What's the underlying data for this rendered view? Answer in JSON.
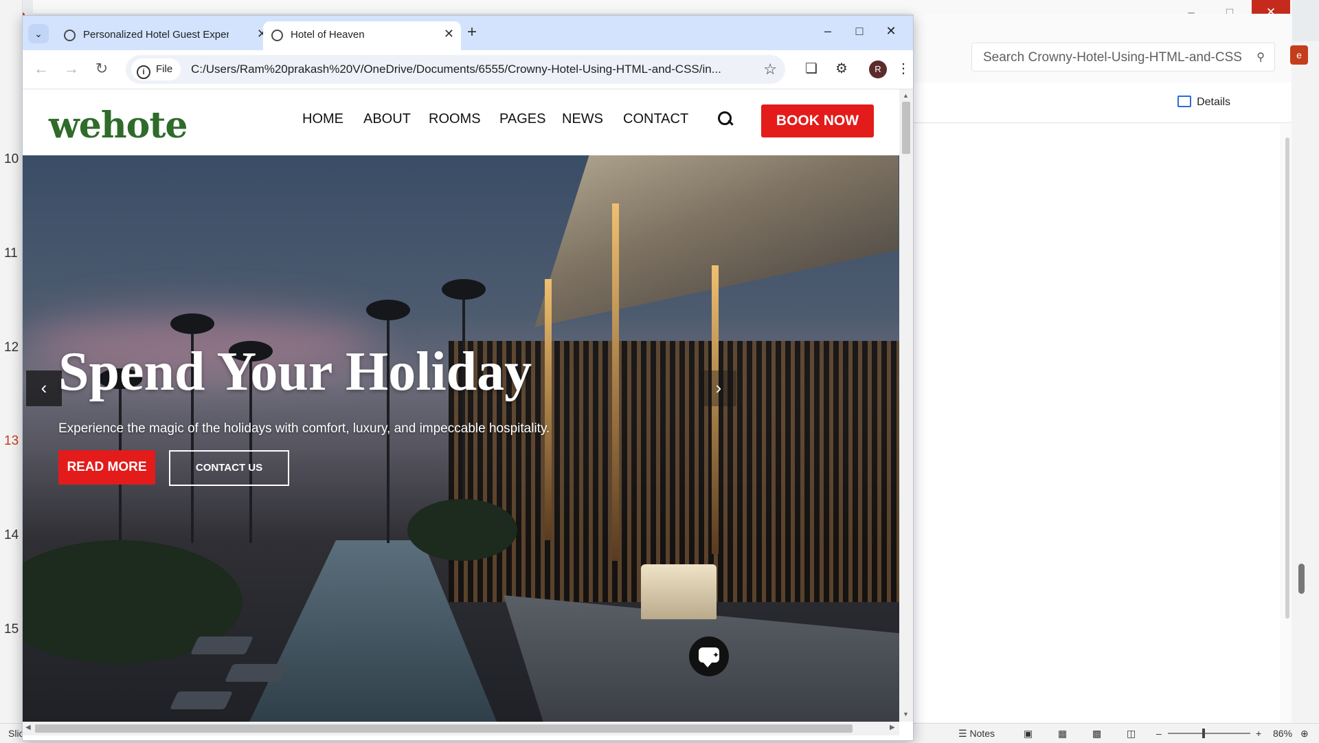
{
  "background_app": {
    "slide_numbers": [
      "10",
      "11",
      "12",
      "13",
      "14",
      "15"
    ],
    "active_slide": "13",
    "explorer_search_placeholder": "Search Crowny-Hotel-Using-HTML-and-CSS",
    "details_label": "Details",
    "status_left": "Slic",
    "notes_label": "Notes",
    "zoom_level": "86%"
  },
  "browser": {
    "tabs": [
      {
        "title": "Personalized Hotel Guest Experi",
        "active": false
      },
      {
        "title": "Hotel of Heaven",
        "active": true
      }
    ],
    "address": {
      "chip_label": "File",
      "url": "C:/Users/Ram%20prakash%20V/OneDrive/Documents/6555/Crowny-Hotel-Using-HTML-and-CSS/in..."
    },
    "profile_initial": "R"
  },
  "site": {
    "logo": "wehote",
    "nav": [
      "HOME",
      "ABOUT",
      "ROOMS",
      "PAGES",
      "NEWS",
      "CONTACT"
    ],
    "book_now": "BOOK NOW",
    "hero": {
      "title": "Spend Your Holiday",
      "subtitle": "Experience the magic of the holidays with comfort, luxury, and impeccable hospitality.",
      "read_more": "READ MORE",
      "contact_us": "CONTACT US"
    }
  },
  "colors": {
    "accent_red": "#e31b1b",
    "logo_green": "#2f6b2a",
    "tabstrip_blue": "#d3e3fd"
  }
}
